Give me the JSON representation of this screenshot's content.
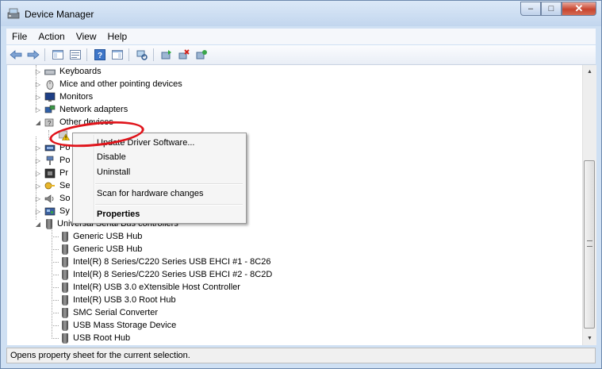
{
  "window": {
    "title": "Device Manager",
    "icon": "device-manager-icon"
  },
  "caption_buttons": {
    "minimize": "–",
    "maximize": "□",
    "close": "✕"
  },
  "menu": [
    "File",
    "Action",
    "View",
    "Help"
  ],
  "toolbar": {
    "icons": [
      "back-arrow-icon",
      "forward-arrow-icon",
      "show-hide-console-tree-icon",
      "properties-icon",
      "help-icon",
      "show-action-pane-icon",
      "scan-hardware-icon",
      "update-driver-icon",
      "uninstall-icon",
      "enable-device-icon"
    ]
  },
  "tree": {
    "items": [
      {
        "label": "Keyboards",
        "icon": "keyboard-icon",
        "expander": "▷"
      },
      {
        "label": "Mice and other pointing devices",
        "icon": "mouse-icon",
        "expander": "▷"
      },
      {
        "label": "Monitors",
        "icon": "monitor-icon",
        "expander": "▷"
      },
      {
        "label": "Network adapters",
        "icon": "network-adapter-icon",
        "expander": "▷"
      },
      {
        "label": "Other devices",
        "icon": "other-devices-icon",
        "expander": "◢"
      },
      {
        "label": "",
        "icon": "unknown-device-warning-icon",
        "expander": ""
      },
      {
        "label": "Po",
        "icon": "ports-icon",
        "expander": "▷"
      },
      {
        "label": "Po",
        "icon": "power-icon",
        "expander": "▷"
      },
      {
        "label": "Pr",
        "icon": "processor-icon",
        "expander": "▷"
      },
      {
        "label": "Se",
        "icon": "security-devices-icon",
        "expander": "▷"
      },
      {
        "label": "So",
        "icon": "sound-icon",
        "expander": "▷"
      },
      {
        "label": "Sy",
        "icon": "system-devices-icon",
        "expander": "▷"
      },
      {
        "label": "Universal Serial Bus controllers",
        "icon": "usb-controller-icon",
        "expander": "◢"
      }
    ],
    "usb_children": [
      "Generic USB Hub",
      "Generic USB Hub",
      "Intel(R) 8 Series/C220 Series USB EHCI #1 - 8C26",
      "Intel(R) 8 Series/C220 Series USB EHCI #2 - 8C2D",
      "Intel(R) USB 3.0 eXtensible Host Controller",
      "Intel(R) USB 3.0 Root Hub",
      "SMC Serial Converter",
      "USB Mass Storage Device",
      "USB Root Hub"
    ]
  },
  "context_menu": {
    "items": [
      {
        "label": "Update Driver Software...",
        "bold": false
      },
      {
        "label": "Disable",
        "bold": false
      },
      {
        "label": "Uninstall",
        "bold": false
      },
      {
        "label": "Scan for hardware changes",
        "bold": false
      },
      {
        "label": "Properties",
        "bold": true
      }
    ]
  },
  "status_bar": {
    "text": "Opens property sheet for the current selection."
  },
  "colors": {
    "highlight_ellipse": "#e0141b",
    "warning": "#f2c400"
  }
}
